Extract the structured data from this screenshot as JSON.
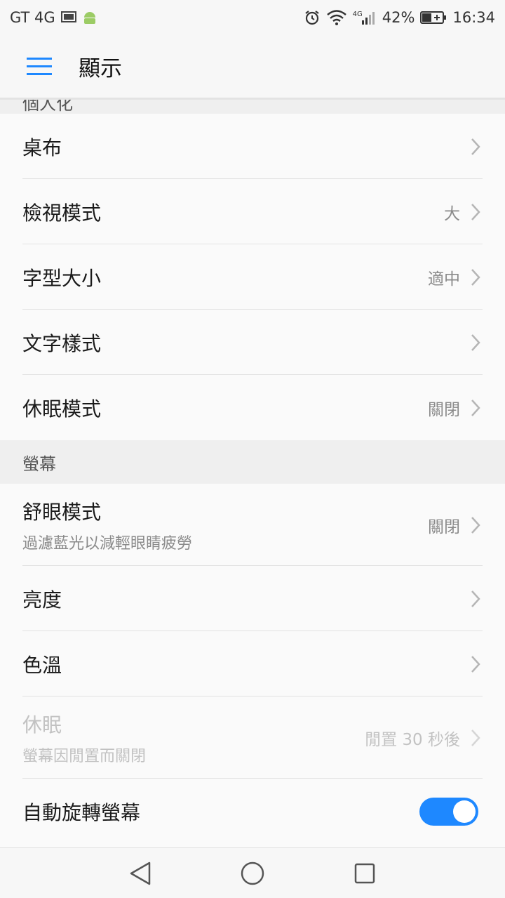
{
  "status_bar": {
    "carrier": "GT 4G",
    "signal_badge": "4G",
    "battery_percent": "42%",
    "time": "16:34"
  },
  "app_bar": {
    "title": "顯示"
  },
  "sections": {
    "personalize": {
      "header": "個人化",
      "rows": {
        "wallpaper": {
          "title": "桌布"
        },
        "view_mode": {
          "title": "檢視模式",
          "value": "大"
        },
        "font_size": {
          "title": "字型大小",
          "value": "適中"
        },
        "text_style": {
          "title": "文字樣式"
        },
        "daydream": {
          "title": "休眠模式",
          "value": "關閉"
        }
      }
    },
    "screen": {
      "header": "螢幕",
      "rows": {
        "eye_comfort": {
          "title": "舒眼模式",
          "subtitle": "過濾藍光以減輕眼睛疲勞",
          "value": "關閉"
        },
        "brightness": {
          "title": "亮度"
        },
        "color_temp": {
          "title": "色溫"
        },
        "sleep": {
          "title": "休眠",
          "subtitle": "螢幕因閒置而關閉",
          "value": "閒置 30 秒後"
        },
        "auto_rotate": {
          "title": "自動旋轉螢幕",
          "enabled": true
        }
      }
    }
  },
  "colors": {
    "accent": "#1e88ff",
    "toggle_on": "#1e88ff"
  }
}
